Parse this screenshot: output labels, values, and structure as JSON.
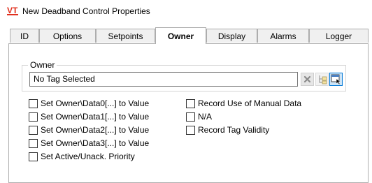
{
  "window": {
    "app_icon_text": "VT",
    "title": "New Deadband Control Properties"
  },
  "tabs": [
    {
      "label": "ID",
      "active": false
    },
    {
      "label": "Options",
      "active": false
    },
    {
      "label": "Setpoints",
      "active": false
    },
    {
      "label": "Owner",
      "active": true
    },
    {
      "label": "Display",
      "active": false
    },
    {
      "label": "Alarms",
      "active": false
    },
    {
      "label": "Logger",
      "active": false
    }
  ],
  "owner_group": {
    "label": "Owner",
    "field_value": "No Tag Selected",
    "buttons": [
      {
        "icon": "clear-x-icon"
      },
      {
        "icon": "tag-tree-icon"
      },
      {
        "icon": "select-tag-icon"
      }
    ]
  },
  "checkboxes_left": [
    {
      "label": "Set Owner\\Data0[...] to Value",
      "checked": false
    },
    {
      "label": "Set Owner\\Data1[...] to Value",
      "checked": false
    },
    {
      "label": "Set Owner\\Data2[...] to Value",
      "checked": false
    },
    {
      "label": "Set Owner\\Data3[...] to Value",
      "checked": false
    },
    {
      "label": "Set Active/Unack. Priority",
      "checked": false
    }
  ],
  "checkboxes_right": [
    {
      "label": "Record Use of Manual Data",
      "checked": false
    },
    {
      "label": "N/A",
      "checked": false
    },
    {
      "label": "Record Tag Validity",
      "checked": false
    }
  ],
  "colors": {
    "accent": "#0078d7",
    "icon_red": "#e0301e",
    "border": "#adadad"
  }
}
